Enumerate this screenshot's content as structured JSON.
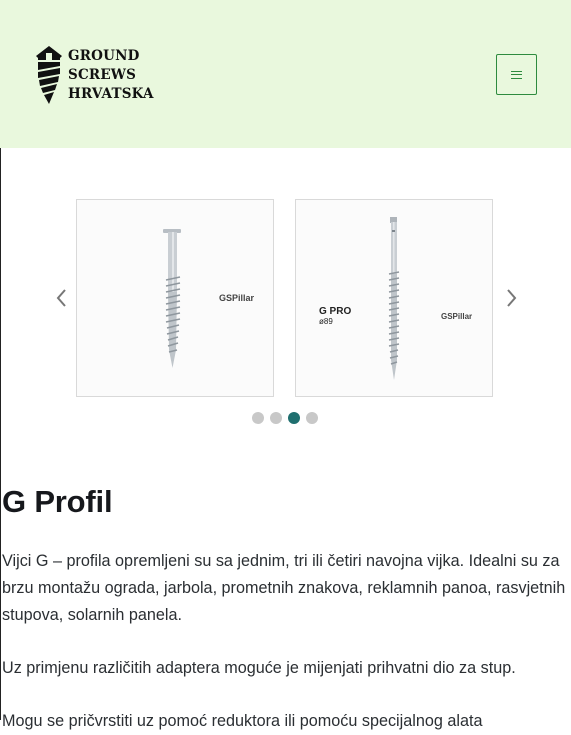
{
  "header": {
    "logo_lines": [
      "GROUND",
      "SCREWS",
      "HRVATSKA"
    ],
    "menu_icon": "hamburger-icon",
    "background": "#e9f8dd",
    "accent": "#2e8b3e"
  },
  "carousel": {
    "prev_icon": "chevron-left-icon",
    "next_icon": "chevron-right-icon",
    "slides": [
      {
        "image": "ground-screw-image",
        "brand": "GSPillar"
      },
      {
        "image": "ground-screw-image",
        "model_line1": "G PRO",
        "model_line2": "ø89",
        "brand": "GSPillar"
      }
    ],
    "dot_count": 4,
    "active_dot": 3,
    "active_color": "#1f6f6f"
  },
  "content": {
    "title": "G Profil",
    "paragraphs": [
      "Vijci G – profila opremljeni su sa jednim, tri ili četiri navojna vijka. Idealni su za brzu montažu ograda, jarbola, prometnih znakova, reklamnih panoa, rasvjetnih stupova, solarnih panela.",
      "Uz primjenu različitih adaptera moguće je mijenjati prihvatni dio za stup.",
      "Mogu se pričvrstiti uz pomoć reduktora ili pomoću specijalnog alata"
    ]
  }
}
